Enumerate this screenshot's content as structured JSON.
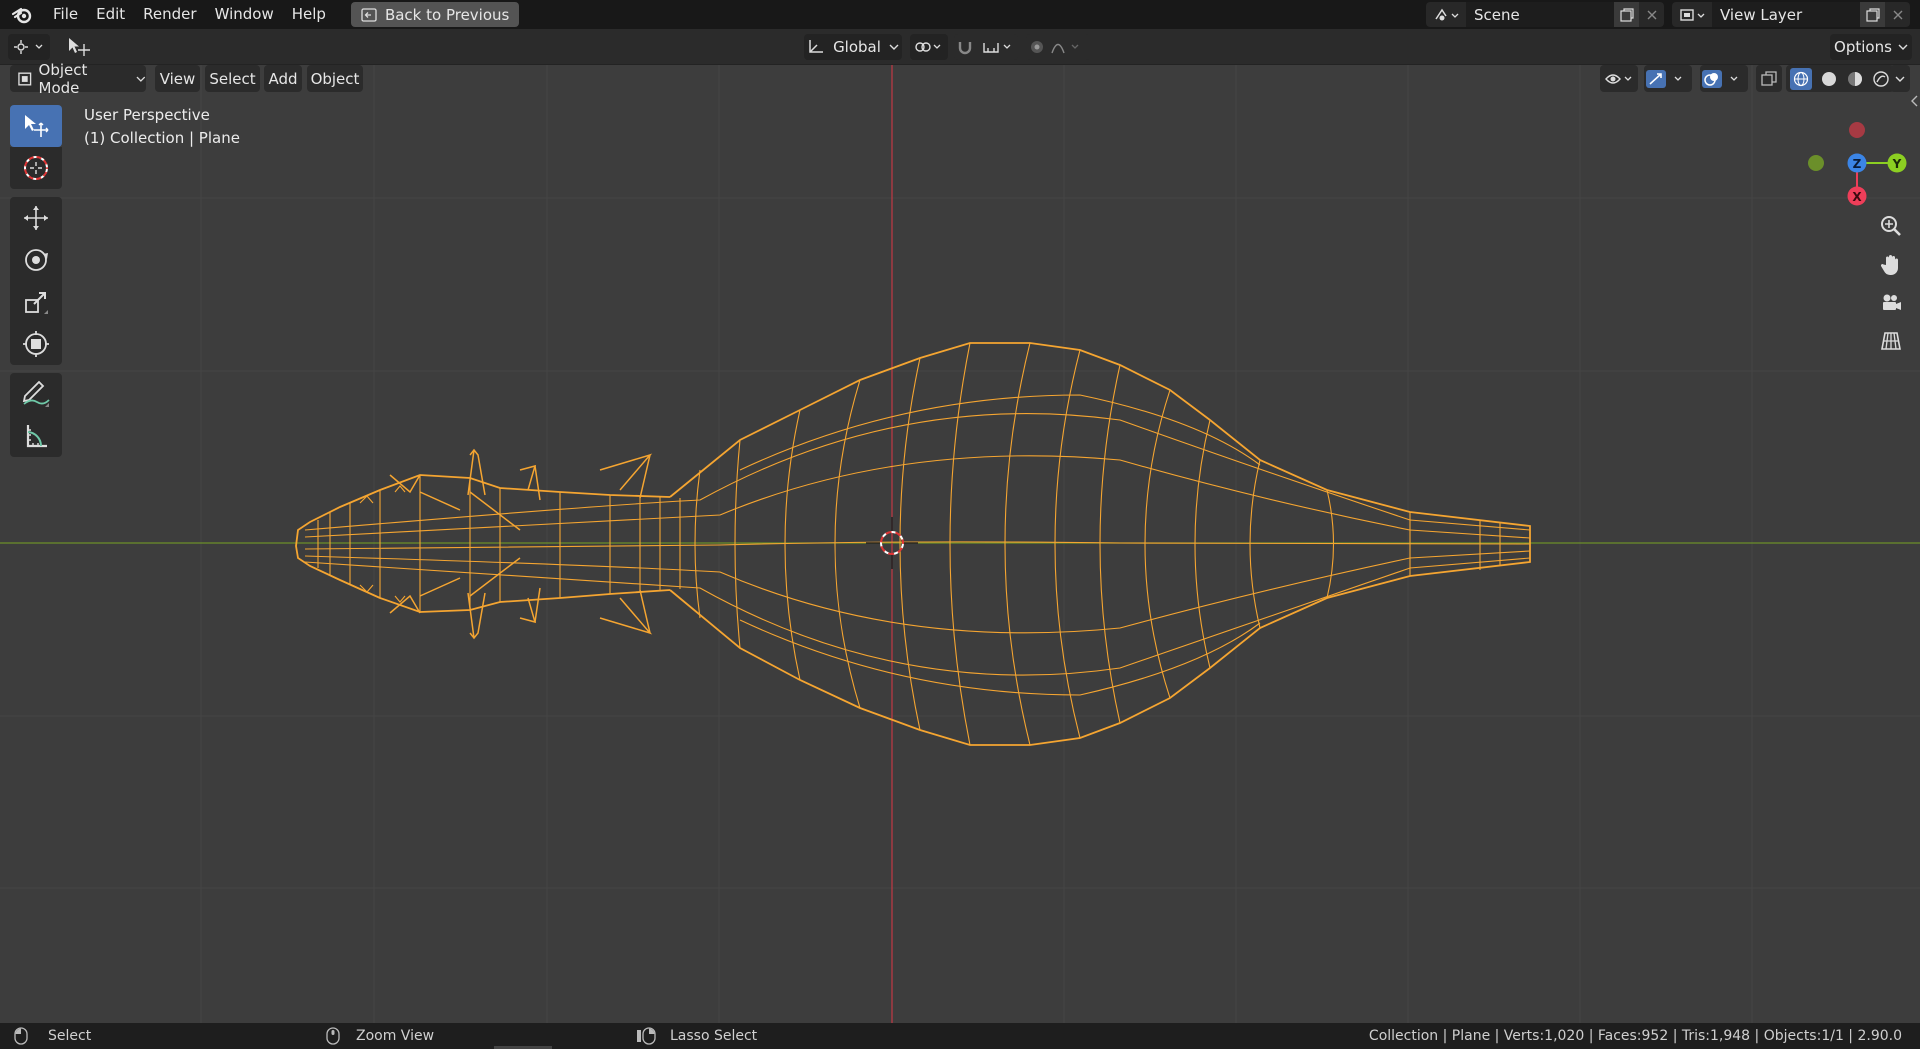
{
  "topbar": {
    "menus": [
      "File",
      "Edit",
      "Render",
      "Window",
      "Help"
    ],
    "back_label": "Back to Previous",
    "scene_name": "Scene",
    "view_layer_name": "View Layer"
  },
  "tool_header": {
    "orientation": "Global",
    "options_label": "Options"
  },
  "viewport_header": {
    "mode": "Object Mode",
    "menus": [
      "View",
      "Select",
      "Add",
      "Object"
    ]
  },
  "viewport": {
    "perspective_label": "User Perspective",
    "collection_label": "(1) Collection | Plane"
  },
  "gizmo": {
    "z_label": "Z",
    "y_label": "Y",
    "x_label": "X",
    "x_color": "#ee3e59",
    "y_color": "#8ccf22",
    "z_color": "#3b85e6"
  },
  "statusbar": {
    "select_label": "Select",
    "zoom_label": "Zoom View",
    "lasso_label": "Lasso Select",
    "stats": "Collection | Plane | Verts:1,020 | Faces:952 | Tris:1,948 | Objects:1/1 | 2.90.0"
  },
  "colors": {
    "wire": "#f5a531",
    "active_tool": "#4772b3",
    "axis_x": "#b83a44",
    "axis_y": "#6b8f2a"
  }
}
